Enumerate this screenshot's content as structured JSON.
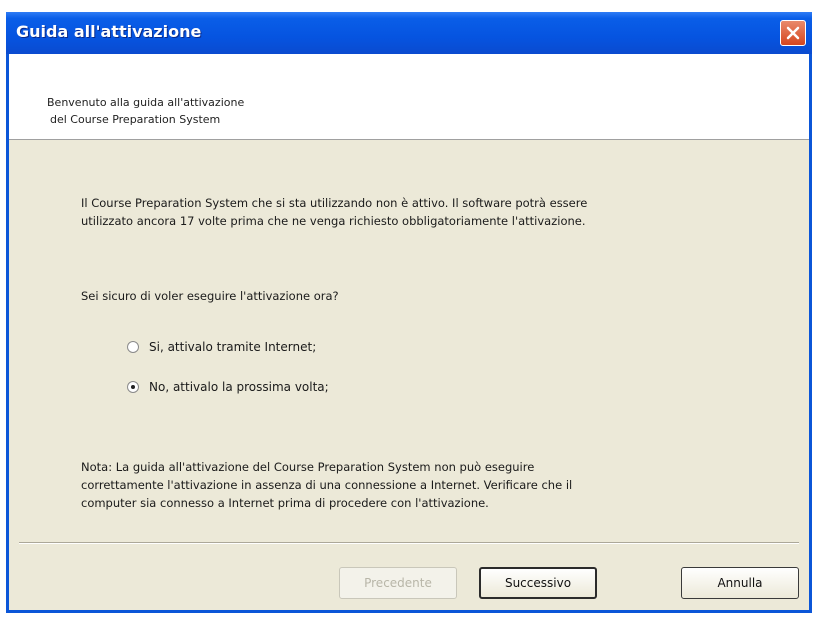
{
  "window": {
    "title": "Guida all'attivazione"
  },
  "header": {
    "line1": "Benvenuto alla guida all'attivazione",
    "line2": "del Course Preparation System"
  },
  "body": {
    "paragraph_line1": "Il Course Preparation System che si sta utilizzando non è attivo. Il software potrà essere",
    "paragraph_line2": "utilizzato ancora 17 volte prima che ne venga richiesto obbligatoriamente l'attivazione.",
    "question": "Sei sicuro di voler eseguire l'attivazione ora?",
    "options": [
      {
        "label": "Si, attivalo tramite Internet;",
        "selected": false
      },
      {
        "label": "No, attivalo la prossima volta;",
        "selected": true
      }
    ],
    "note_line1": "Nota: La guida all'attivazione del Course Preparation System non può eseguire",
    "note_line2": "correttamente l'attivazione in assenza di una connessione a Internet. Verificare che il",
    "note_line3": "computer sia connesso a Internet prima di procedere con l'attivazione."
  },
  "buttons": {
    "previous": "Precedente",
    "next": "Successivo",
    "cancel": "Annulla"
  },
  "colors": {
    "titlebar": "#0654e0",
    "dialog_bg": "#ece9d8",
    "close_button": "#d5461f"
  }
}
